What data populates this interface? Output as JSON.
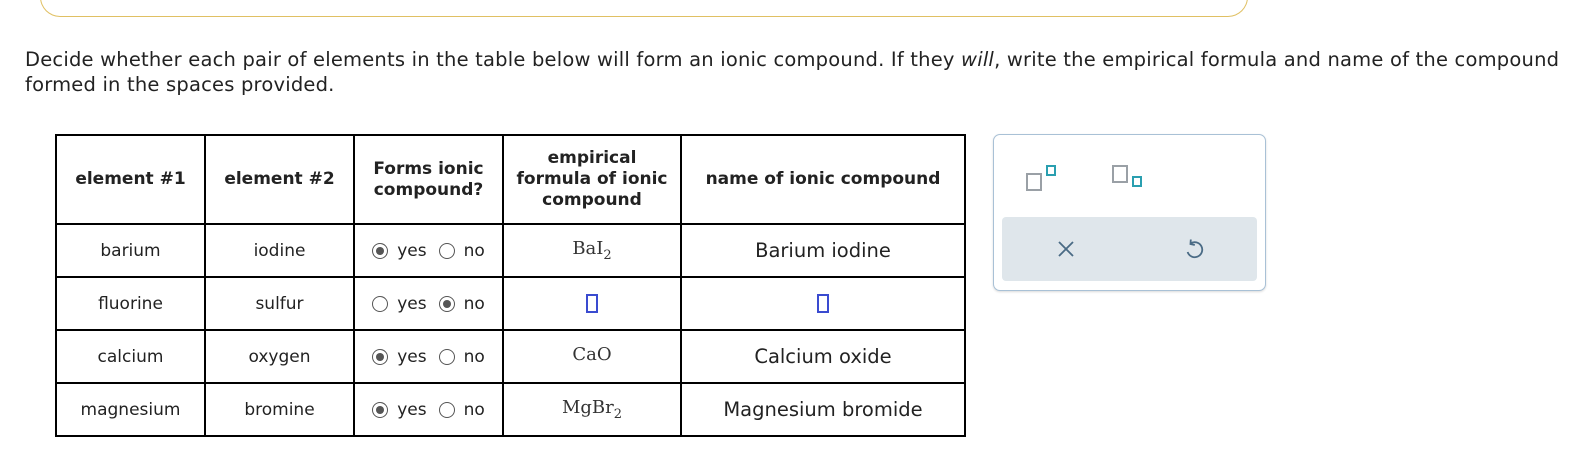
{
  "instructions": {
    "part1": "Decide whether each pair of elements in the table below will form an ionic compound. If they ",
    "emphasis": "will",
    "part2": ", write the empirical formula and name of the compound",
    "line2": "formed in the spaces provided."
  },
  "table": {
    "headers": {
      "element1": "element #1",
      "element2": "element #2",
      "forms_line1": "Forms ionic",
      "forms_line2": "compound?",
      "formula_line1": "empirical",
      "formula_line2": "formula of ionic",
      "formula_line3": "compound",
      "name": "name of ionic compound"
    },
    "yes_label": "yes",
    "no_label": "no",
    "rows": [
      {
        "element1": "barium",
        "element2": "iodine",
        "forms": "yes",
        "formula_base": "BaI",
        "formula_sub": "2",
        "name": "Barium iodine"
      },
      {
        "element1": "fluorine",
        "element2": "sulfur",
        "forms": "no",
        "formula_base": "",
        "formula_sub": "",
        "name": ""
      },
      {
        "element1": "calcium",
        "element2": "oxygen",
        "forms": "yes",
        "formula_base": "CaO",
        "formula_sub": "",
        "name": "Calcium oxide"
      },
      {
        "element1": "magnesium",
        "element2": "bromine",
        "forms": "yes",
        "formula_base": "MgBr",
        "formula_sub": "2",
        "name": "Magnesium bromide"
      }
    ]
  },
  "toolbar": {
    "superscript_icon": "superscript-icon",
    "subscript_icon": "subscript-icon",
    "clear_icon": "close-icon",
    "undo_icon": "undo-icon",
    "accent_color": "#2a9fb0",
    "input_border_color": "#3a4bd0"
  }
}
